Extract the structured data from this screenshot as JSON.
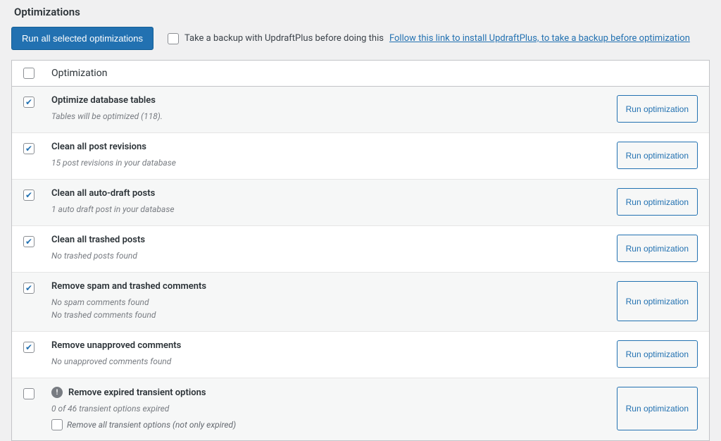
{
  "page": {
    "title": "Optimizations"
  },
  "actions": {
    "run_all": "Run all selected optimizations",
    "backup_text": "Take a backup with UpdraftPlus before doing this",
    "backup_link": "Follow this link to install UpdraftPlus, to take a backup before optimization",
    "run_one": "Run optimization"
  },
  "table": {
    "header": "Optimization"
  },
  "rows": [
    {
      "checked": true,
      "icon": false,
      "title": "Optimize database tables",
      "subs": [
        "Tables will be optimized (118)."
      ],
      "sub_check": null
    },
    {
      "checked": true,
      "icon": false,
      "title": "Clean all post revisions",
      "subs": [
        "15 post revisions in your database"
      ],
      "sub_check": null
    },
    {
      "checked": true,
      "icon": false,
      "title": "Clean all auto-draft posts",
      "subs": [
        "1 auto draft post in your database"
      ],
      "sub_check": null
    },
    {
      "checked": true,
      "icon": false,
      "title": "Clean all trashed posts",
      "subs": [
        "No trashed posts found"
      ],
      "sub_check": null
    },
    {
      "checked": true,
      "icon": false,
      "title": "Remove spam and trashed comments",
      "subs": [
        "No spam comments found",
        "No trashed comments found"
      ],
      "sub_check": null
    },
    {
      "checked": true,
      "icon": false,
      "title": "Remove unapproved comments",
      "subs": [
        "No unapproved comments found"
      ],
      "sub_check": null
    },
    {
      "checked": false,
      "icon": true,
      "title": "Remove expired transient options",
      "subs": [
        "0 of 46 transient options expired"
      ],
      "sub_check": {
        "checked": false,
        "label": "Remove all transient options (not only expired)"
      }
    }
  ]
}
